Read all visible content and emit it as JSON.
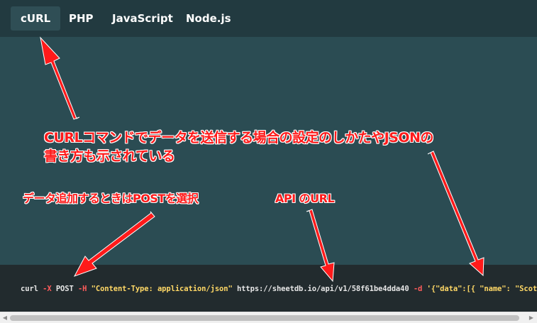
{
  "tabs": [
    {
      "label": "cURL",
      "active": true
    },
    {
      "label": "PHP",
      "active": false
    },
    {
      "label": "JavaScript",
      "active": false
    },
    {
      "label": "Node.js",
      "active": false
    }
  ],
  "code": {
    "cmd": "curl",
    "flag_x": "-X",
    "method": "POST",
    "flag_h": "-H",
    "header": "\"Content-Type: application/json\"",
    "url": "https://sheetdb.io/api/v1/58f61be4dda40",
    "flag_d": "-d",
    "payload": "'{\"data\":[{ \"name\": \"Scot"
  },
  "annotations": {
    "curl_note_line1": "CURLコマンドでデータを送信する場合の設定のしかたやJSONの",
    "curl_note_line2": "書き方も示されている",
    "post_note": "データ追加するときはPOSTを選択",
    "api_note": "API のURL"
  },
  "colors": {
    "tabbar_bg": "#223a40",
    "panel_bg": "#2b4c53",
    "code_bg": "#222b2e",
    "annotation_red": "#ff1a1a",
    "string_yellow": "#ffd866",
    "flag_red": "#ff5b5b"
  }
}
